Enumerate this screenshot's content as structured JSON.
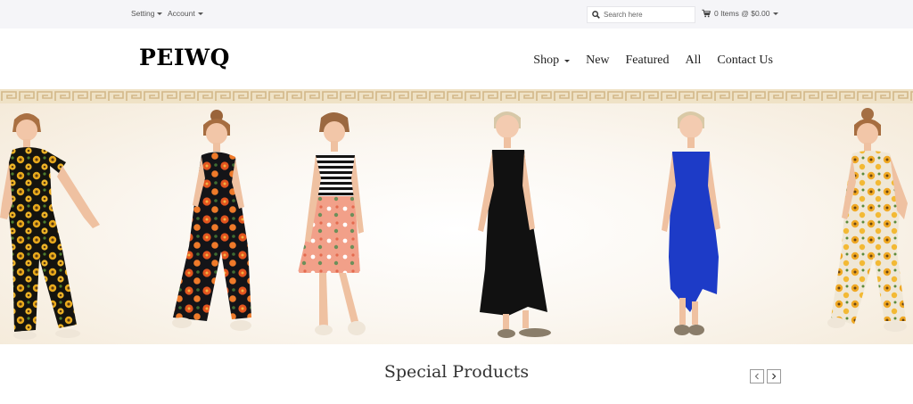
{
  "topbar": {
    "setting_label": "Setting",
    "account_label": "Account",
    "search_placeholder": "Search here",
    "cart_label": "0 Items @ $0.00"
  },
  "header": {
    "logo": "PEIWQ",
    "nav": [
      {
        "label": "Shop",
        "has_dropdown": true
      },
      {
        "label": "New"
      },
      {
        "label": "Featured"
      },
      {
        "label": "All"
      },
      {
        "label": "Contact Us"
      }
    ]
  },
  "banner": {
    "kids": [
      {
        "outfit": "black sunflower jumpsuit"
      },
      {
        "outfit": "black orange floral jumpsuit"
      },
      {
        "outfit": "striped top pink floral dress"
      },
      {
        "outfit": "black sleeveless maxi dress"
      },
      {
        "outfit": "blue sleeveless maxi dress"
      },
      {
        "outfit": "white sunflower jumpsuit"
      }
    ]
  },
  "special": {
    "title": "Special Products",
    "prev_icon": "chevron-left-icon",
    "next_icon": "chevron-right-icon"
  },
  "colors": {
    "topbar_bg": "#f5f5f8",
    "banner_border": "#efe2c6",
    "text": "#333333"
  }
}
